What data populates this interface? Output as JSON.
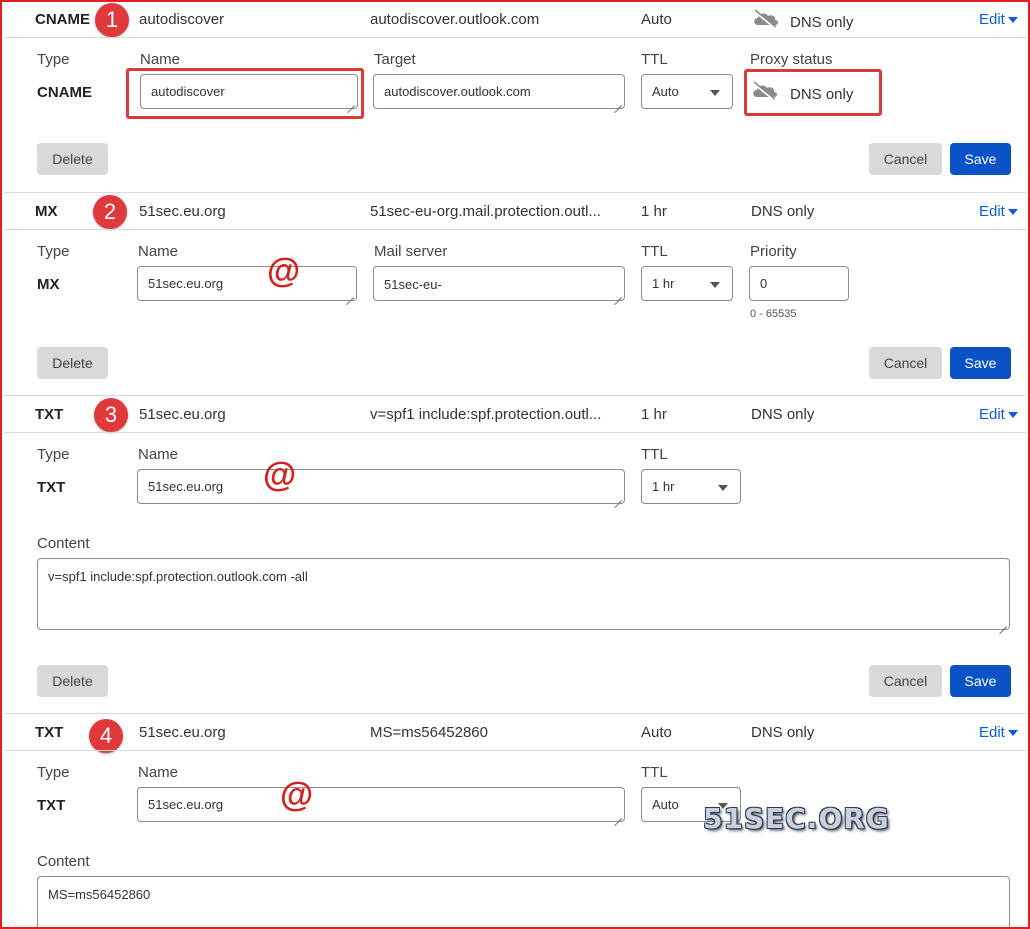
{
  "records": [
    {
      "summary": {
        "type": "CNAME",
        "name": "autodiscover",
        "content": "autodiscover.outlook.com",
        "ttl": "Auto",
        "proxy": "DNS only",
        "edit": "Edit",
        "badge": "1"
      },
      "editor": {
        "type_label": "Type",
        "type_value": "CNAME",
        "name_label": "Name",
        "name_value": "autodiscover",
        "target_label": "Target",
        "target_value": "autodiscover.outlook.com",
        "ttl_label": "TTL",
        "ttl_value": "Auto",
        "proxy_label": "Proxy status",
        "proxy_value": "DNS only"
      },
      "delete": "Delete",
      "cancel": "Cancel",
      "save": "Save"
    },
    {
      "summary": {
        "type": "MX",
        "name": "51sec.eu.org",
        "content": "51sec-eu-org.mail.protection.outl...",
        "ttl": "1 hr",
        "proxy": "DNS only",
        "edit": "Edit",
        "badge": "2"
      },
      "editor": {
        "type_label": "Type",
        "type_value": "MX",
        "name_label": "Name",
        "name_value": "51sec.eu.org",
        "mail_label": "Mail server",
        "mail_value": "51sec-eu-",
        "ttl_label": "TTL",
        "ttl_value": "1 hr",
        "priority_label": "Priority",
        "priority_value": "0",
        "priority_hint": "0 - 65535"
      },
      "annotation": "@",
      "delete": "Delete",
      "cancel": "Cancel",
      "save": "Save"
    },
    {
      "summary": {
        "type": "TXT",
        "name": "51sec.eu.org",
        "content": "v=spf1 include:spf.protection.outl...",
        "ttl": "1 hr",
        "proxy": "DNS only",
        "edit": "Edit",
        "badge": "3"
      },
      "editor": {
        "type_label": "Type",
        "type_value": "TXT",
        "name_label": "Name",
        "name_value": "51sec.eu.org",
        "ttl_label": "TTL",
        "ttl_value": "1 hr",
        "content_label": "Content",
        "content_value": "v=spf1 include:spf.protection.outlook.com -all"
      },
      "annotation": "@",
      "delete": "Delete",
      "cancel": "Cancel",
      "save": "Save"
    },
    {
      "summary": {
        "type": "TXT",
        "name": "51sec.eu.org",
        "content": "MS=ms56452860",
        "ttl": "Auto",
        "proxy": "DNS only",
        "edit": "Edit",
        "badge": "4"
      },
      "editor": {
        "type_label": "Type",
        "type_value": "TXT",
        "name_label": "Name",
        "name_value": "51sec.eu.org",
        "ttl_label": "TTL",
        "ttl_value": "Auto",
        "content_label": "Content",
        "content_value": "MS=ms56452860"
      },
      "annotation": "@"
    }
  ],
  "watermark": "51SEC.ORG",
  "colors": {
    "accent": "#0b52c7",
    "annotation": "#e0393b",
    "cloud": "#8a8a8a"
  }
}
